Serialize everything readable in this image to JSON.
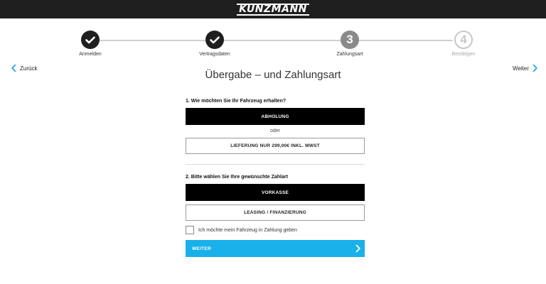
{
  "header": {
    "logo_text": "KUNZMANN"
  },
  "steps": [
    {
      "number": "1",
      "label": "Anmelden",
      "status": "done"
    },
    {
      "number": "2",
      "label": "Vertragsdaten",
      "status": "done"
    },
    {
      "number": "3",
      "label": "Zahlungsart",
      "status": "current"
    },
    {
      "number": "4",
      "label": "Bestätigen",
      "status": "future"
    }
  ],
  "nav": {
    "back_label": "Zurück",
    "next_label": "Weiter"
  },
  "page": {
    "title": "Übergabe – und Zahlungsart"
  },
  "delivery": {
    "question": "1. Wie möchten Sie Ihr Fahrzeug erhalten?",
    "option_pickup": "ABHOLUNG",
    "separator": "oder",
    "option_delivery": "LIEFERUNG NUR 299,00€ INKL. MWST"
  },
  "payment": {
    "question": "2. Bitte wählen Sie Ihre gewünschte Zahlart",
    "option_prepay": "VORKASSE",
    "option_leasing": "LEASING / FINANZIERUNG"
  },
  "trade_in": {
    "label": "Ich möchte mein Fahrzeug in Zahlung geben",
    "checked": false
  },
  "submit": {
    "label": "WEITER"
  },
  "colors": {
    "accent": "#1ab0ea",
    "topbar": "#1f1f1f",
    "selected": "#000000"
  },
  "icons": {
    "done": "check-icon",
    "nav": "chevron-icon"
  }
}
